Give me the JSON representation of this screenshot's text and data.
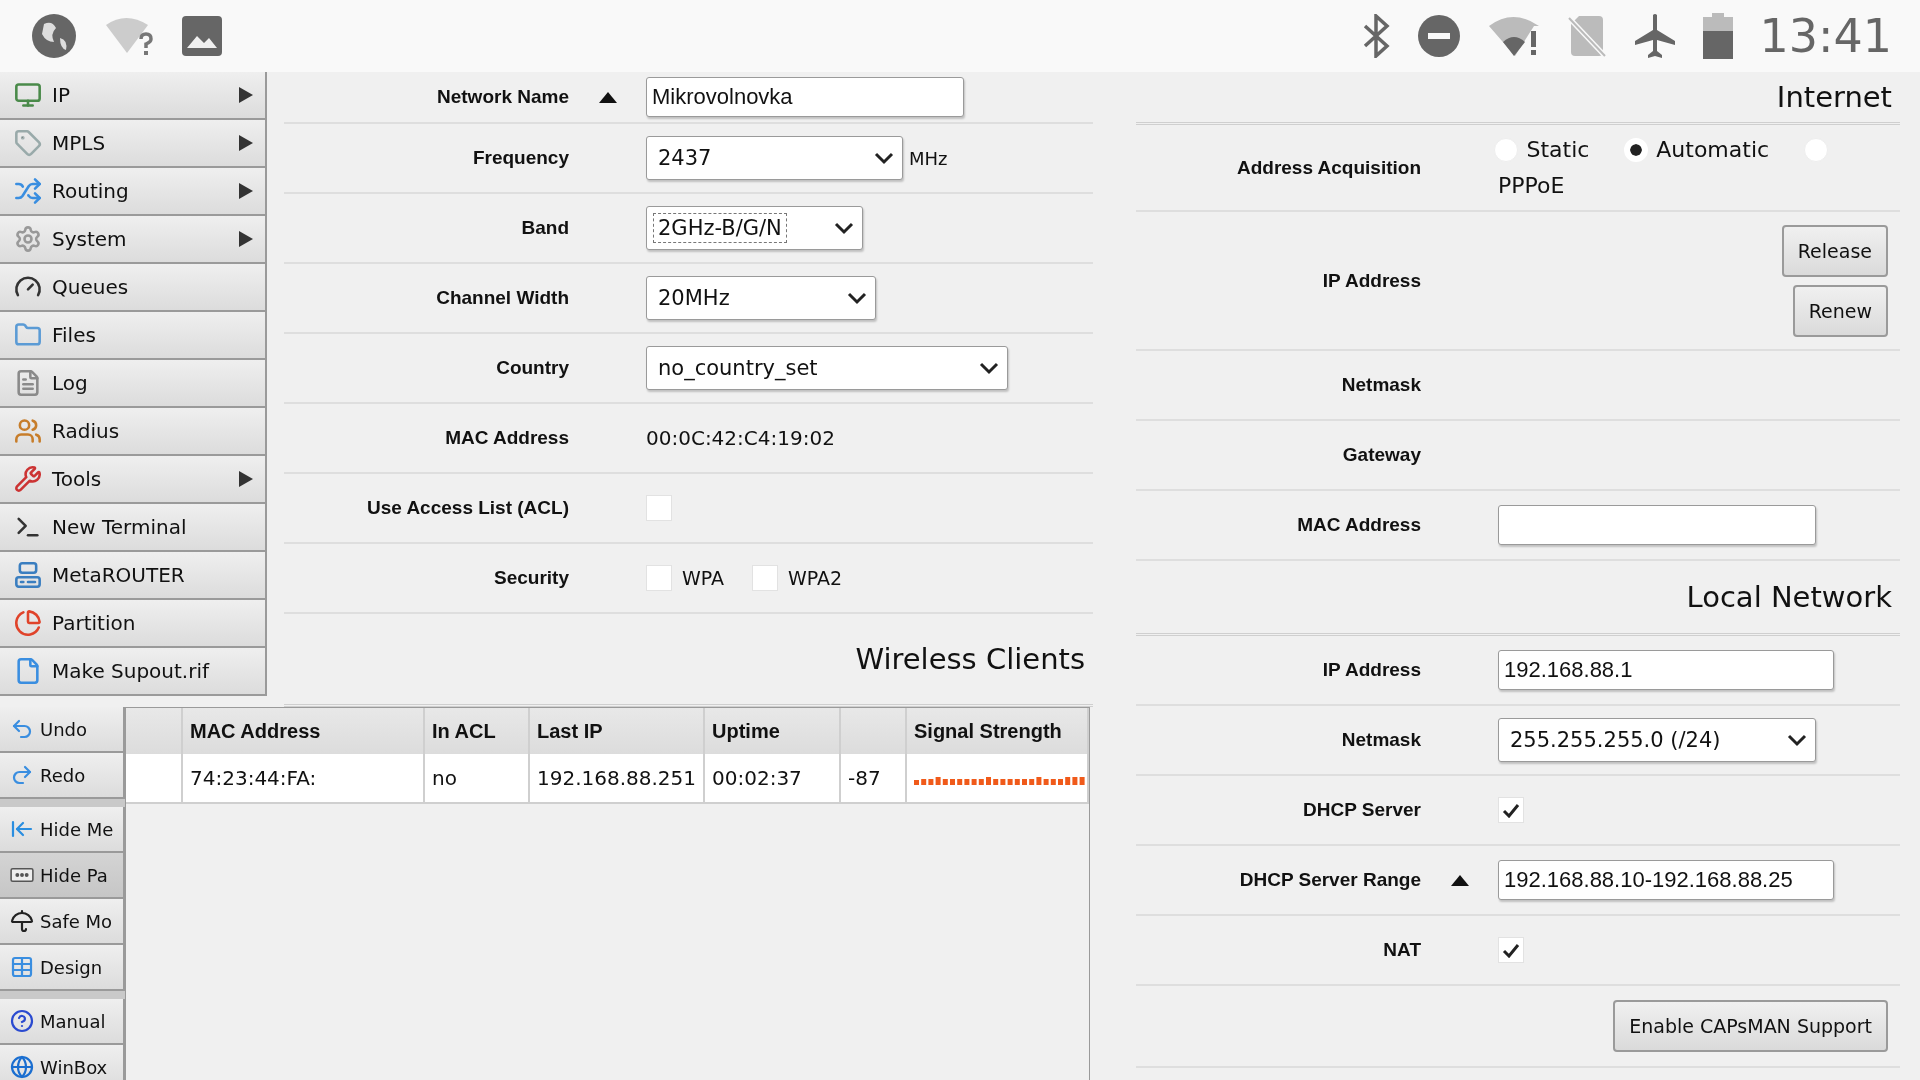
{
  "status_bar": {
    "time": "13:41"
  },
  "sidebar": {
    "groups": [
      {
        "items": [
          {
            "label": "IP",
            "has_submenu": true,
            "selected": false
          },
          {
            "label": "MPLS",
            "has_submenu": true,
            "selected": false
          },
          {
            "label": "Routing",
            "has_submenu": true,
            "selected": false
          },
          {
            "label": "System",
            "has_submenu": true,
            "selected": false
          },
          {
            "label": "Queues",
            "has_submenu": false,
            "selected": false
          },
          {
            "label": "Files",
            "has_submenu": false,
            "selected": false
          },
          {
            "label": "Log",
            "has_submenu": false,
            "selected": false
          },
          {
            "label": "Radius",
            "has_submenu": false,
            "selected": false
          },
          {
            "label": "Tools",
            "has_submenu": true,
            "selected": false
          },
          {
            "label": "New Terminal",
            "has_submenu": false,
            "selected": false
          },
          {
            "label": "MetaROUTER",
            "has_submenu": false,
            "selected": false
          },
          {
            "label": "Partition",
            "has_submenu": false,
            "selected": false
          },
          {
            "label": "Make Supout.rif",
            "has_submenu": false,
            "selected": false
          }
        ]
      },
      {
        "items": [
          {
            "label": "Undo",
            "has_submenu": false,
            "selected": false
          },
          {
            "label": "Redo",
            "has_submenu": false,
            "selected": false
          }
        ]
      },
      {
        "items": [
          {
            "label": "Hide Me",
            "has_submenu": false,
            "selected": false
          },
          {
            "label": "Hide Pa",
            "has_submenu": false,
            "selected": true
          },
          {
            "label": "Safe Mo",
            "has_submenu": false,
            "selected": false
          },
          {
            "label": "Design",
            "has_submenu": false,
            "selected": false
          }
        ]
      },
      {
        "items": [
          {
            "label": "Manual",
            "has_submenu": false,
            "selected": false
          },
          {
            "label": "WinBox",
            "has_submenu": false,
            "selected": false
          }
        ]
      }
    ]
  },
  "wireless": {
    "rows": [
      {
        "kind": "text",
        "label": "Network Name",
        "value": "Mikrovolnovka",
        "toggle": true
      },
      {
        "kind": "select",
        "label": "Frequency",
        "value": "2437",
        "unit": "MHz"
      },
      {
        "kind": "select",
        "label": "Band",
        "value": "2GHz-B/G/N",
        "focused": true
      },
      {
        "kind": "select",
        "label": "Channel Width",
        "value": "20MHz"
      },
      {
        "kind": "select",
        "label": "Country",
        "value": "no_country_set"
      },
      {
        "kind": "readonly",
        "label": "MAC Address",
        "value": "00:0C:42:C4:19:02"
      },
      {
        "kind": "checkbox",
        "label": "Use Access List (ACL)",
        "checked": false
      },
      {
        "kind": "checkgroup",
        "label": "Security",
        "options": [
          {
            "label": "WPA",
            "checked": false
          },
          {
            "label": "WPA2",
            "checked": false
          }
        ]
      }
    ]
  },
  "wireless_clients": {
    "title": "Wireless Clients",
    "columns": [
      "MAC Address",
      "In ACL",
      "Last IP",
      "Uptime",
      null,
      "Signal Strength"
    ],
    "rows": [
      {
        "cells": [
          "74:23:44:FA:",
          "no",
          "192.168.88.251",
          "00:02:37",
          "-87"
        ]
      }
    ]
  },
  "internet": {
    "title": "Internet",
    "rows": [
      {
        "kind": "radio",
        "label": "Address Acquisition",
        "options": [
          {
            "label": "Static",
            "selected": false
          },
          {
            "label": "Automatic",
            "selected": true
          },
          {
            "label": "PPPoE",
            "selected": false
          }
        ]
      },
      {
        "kind": "buttons",
        "label": "IP Address",
        "buttons": [
          "Release",
          "Renew"
        ]
      },
      {
        "kind": "readonly",
        "label": "Netmask"
      },
      {
        "kind": "readonly",
        "label": "Gateway"
      },
      {
        "kind": "text",
        "label": "MAC Address"
      }
    ]
  },
  "local_network": {
    "title": "Local Network",
    "rows": [
      {
        "kind": "text",
        "label": "IP Address",
        "value": "192.168.88.1"
      },
      {
        "kind": "select",
        "label": "Netmask",
        "value": "255.255.255.0 (/24)"
      },
      {
        "kind": "checkbox",
        "label": "DHCP Server",
        "checked": true
      },
      {
        "kind": "text",
        "label": "DHCP Server Range",
        "value": "192.168.88.10-192.168.88.25",
        "toggle": true
      },
      {
        "kind": "checkbox",
        "label": "NAT",
        "checked": true
      }
    ]
  },
  "actions": {
    "button": "Enable CAPsMAN Support"
  }
}
